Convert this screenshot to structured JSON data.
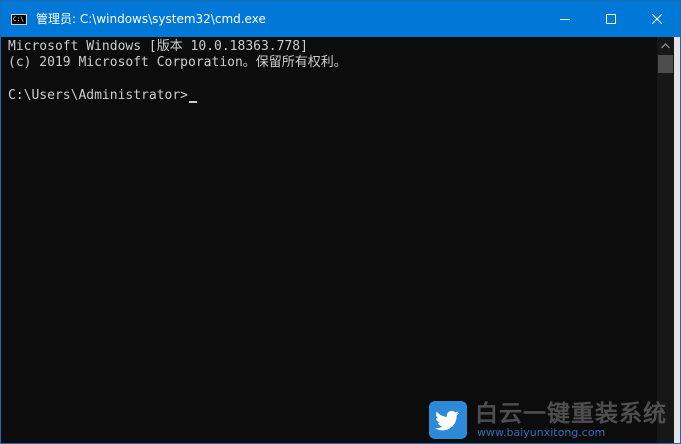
{
  "window": {
    "title": "管理员: C:\\windows\\system32\\cmd.exe",
    "app_icon_text": "C:\\",
    "controls": [
      "minimize",
      "maximize",
      "close"
    ]
  },
  "console": {
    "lines": [
      "Microsoft Windows [版本 10.0.18363.778]",
      "(c) 2019 Microsoft Corporation。保留所有权利。",
      "",
      "C:\\Users\\Administrator>"
    ]
  },
  "watermark": {
    "logo_icon": "twitter-bird-icon",
    "title": "白云一键重装系统",
    "url": "www.baiyunxitong.com"
  },
  "colors": {
    "titlebar": "#0078d7",
    "console_bg": "#0c0c0c",
    "console_text": "#cccccc",
    "scrollbar_track": "#171717",
    "scrollbar_thumb": "#4d4d4d"
  }
}
